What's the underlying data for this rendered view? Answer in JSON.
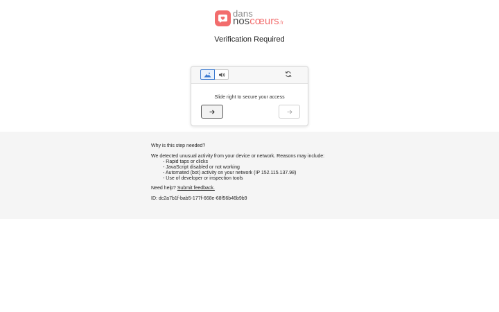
{
  "brand": {
    "line1": "dans",
    "line2_a": "nos",
    "line2_b": "cœurs",
    "tld": ".fr",
    "mark_icon": "heart-chat-icon",
    "color": "#f26d6d"
  },
  "page": {
    "title": "Verification Required"
  },
  "captcha": {
    "modes": [
      {
        "icon": "image-mountain-icon",
        "selected": true
      },
      {
        "icon": "speaker-audio-icon",
        "selected": false
      }
    ],
    "refresh_icon": "refresh-icon",
    "instruction": "Slide right to secure your access",
    "handle_icon": "arrow-right-icon",
    "target_icon": "arrow-right-icon",
    "slider_progress": 0,
    "accent": "#3d7bd0"
  },
  "info": {
    "question": "Why is this step needed?",
    "intro": "We detected unusual activity from your device or network. Reasons may include:",
    "reasons": [
      "- Rapid taps or clicks",
      "- JavaScript disabled or not working",
      "- Automated (bot) activity on your network (IP 152.115.137.98)",
      "- Use of developer or inspection tools"
    ],
    "help_prefix": "Need help?",
    "help_link": "Submit feedback.",
    "id_line": "ID: dc2a7b1f-bab5-177f-668e-68f56b46b9b9"
  }
}
